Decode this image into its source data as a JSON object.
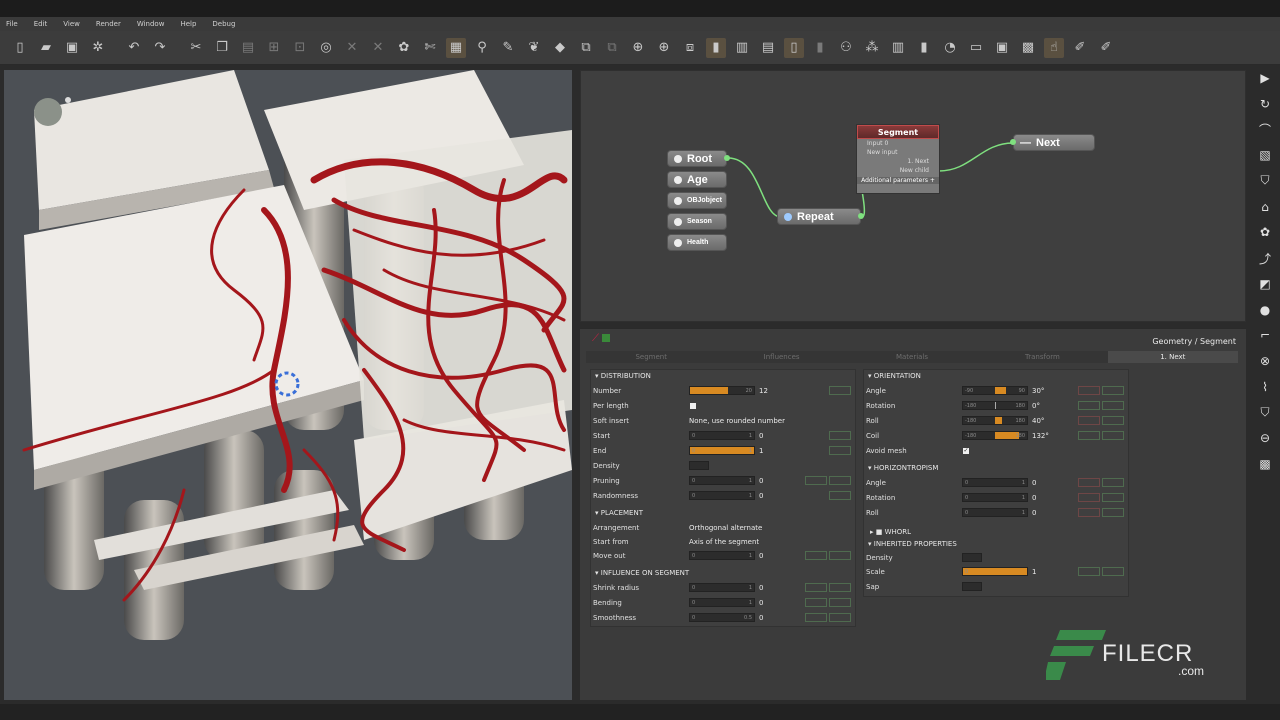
{
  "menu": [
    "File",
    "Edit",
    "View",
    "Render",
    "Window",
    "Help",
    "Debug"
  ],
  "toolbar_icons": [
    "new-file-icon",
    "open-file-icon",
    "save-icon",
    "export-icon",
    "undo-icon",
    "redo-icon",
    "cut-icon",
    "copy-icon",
    "paste-icon",
    "align-icon",
    "fit-icon",
    "camera-icon",
    "delete-icon",
    "close-icon",
    "tree-icon",
    "scissors-icon",
    "grid-icon",
    "brush-icon",
    "pencil-icon",
    "leaf-icon",
    "fill-icon",
    "layers-icon",
    "stack-icon",
    "add-node-icon",
    "add-icon",
    "split-icon",
    "bottle-icon",
    "column-icon",
    "pane-icon",
    "bars-icon",
    "figure-icon",
    "connect-icon",
    "column2-icon",
    "ruler-icon",
    "gauge-icon",
    "film-icon",
    "frame-icon",
    "camera2-icon",
    "hand-icon",
    "wand-icon",
    "wand2-icon",
    "wand3-icon"
  ],
  "graph": {
    "nodes": {
      "root": "Root",
      "age": "Age",
      "objobject": "OBJobject",
      "season": "Season",
      "health": "Health",
      "repeat": "Repeat",
      "next": "Next"
    },
    "segment": {
      "title": "Segment",
      "input0": "Input 0",
      "new_input": "New input",
      "out_next": "1. Next",
      "new_child": "New child",
      "additional": "Additional parameters +"
    }
  },
  "props": {
    "path": "Geometry / Segment",
    "tabs": [
      "Segment",
      "Influences",
      "Materials",
      "Transform",
      "1. Next"
    ],
    "distribution": {
      "title": "DISTRIBUTION",
      "number_label": "Number",
      "number_max": "20",
      "number_value": "12",
      "per_length_label": "Per length",
      "soft_insert_label": "Soft insert",
      "soft_insert_value": "None, use rounded number",
      "start_label": "Start",
      "start_min": "0",
      "start_max": "1",
      "start_value": "0",
      "end_label": "End",
      "end_min": "0",
      "end_max": "1",
      "end_value": "1",
      "density_label": "Density",
      "pruning_label": "Pruning",
      "pruning_min": "0",
      "pruning_max": "1",
      "pruning_value": "0",
      "randomness_label": "Randomness",
      "randomness_min": "0",
      "randomness_max": "1",
      "randomness_value": "0"
    },
    "placement": {
      "title": "PLACEMENT",
      "arrangement_label": "Arrangement",
      "arrangement_value": "Orthogonal alternate",
      "start_from_label": "Start from",
      "start_from_value": "Axis of the segment",
      "move_out_label": "Move out",
      "move_out_min": "0",
      "move_out_max": "1",
      "move_out_value": "0"
    },
    "influence": {
      "title": "INFLUENCE ON SEGMENT",
      "shrink_label": "Shrink radius",
      "shrink_min": "0",
      "shrink_max": "1",
      "shrink_value": "0",
      "bending_label": "Bending",
      "bending_min": "0",
      "bending_max": "1",
      "bending_value": "0",
      "smooth_label": "Smoothness",
      "smooth_min": "0",
      "smooth_max": "0.5",
      "smooth_value": "0"
    },
    "orientation": {
      "title": "ORIENTATION",
      "angle_label": "Angle",
      "angle_min": "-90",
      "angle_max": "90",
      "angle_value": "30°",
      "rotation_label": "Rotation",
      "rotation_min": "-180",
      "rotation_max": "180",
      "rotation_value": "0°",
      "roll_label": "Roll",
      "roll_min": "-180",
      "roll_max": "180",
      "roll_value": "40°",
      "coil_label": "Coil",
      "coil_min": "-180",
      "coil_max": "180",
      "coil_value": "132°",
      "avoid_label": "Avoid mesh",
      "avoid_check": "✓"
    },
    "horizontropism": {
      "title": "HORIZONTROPISM",
      "angle_label": "Angle",
      "angle_min": "0",
      "angle_max": "1",
      "angle_value": "0",
      "rotation_label": "Rotation",
      "rotation_min": "0",
      "rotation_max": "1",
      "rotation_value": "0",
      "roll_label": "Roll",
      "roll_min": "0",
      "roll_max": "1",
      "roll_value": "0"
    },
    "whorl": {
      "title": "WHORL"
    },
    "inherited": {
      "title": "INHERITED PROPERTIES",
      "density_label": "Density",
      "scale_label": "Scale",
      "scale_min": "0",
      "scale_value": "1",
      "sap_label": "Sap"
    }
  },
  "watermark": {
    "brand": "FILECR",
    "domain": ".com"
  },
  "colors": {
    "accent": "#d88a22",
    "vines": "#a4161b",
    "node_pin": "#7fe07f",
    "segment_header": "#8a3a3a"
  }
}
